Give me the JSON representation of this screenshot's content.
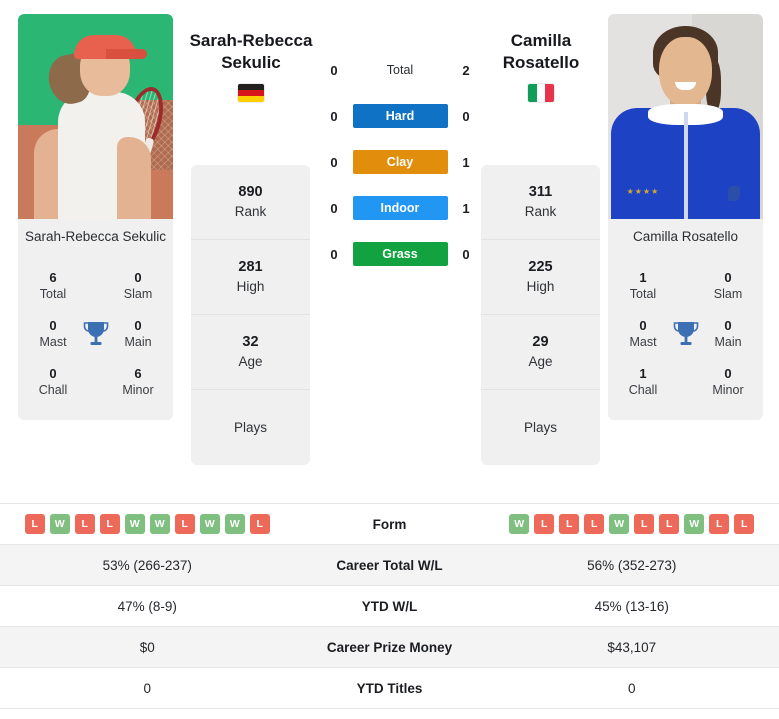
{
  "players": {
    "left": {
      "name": "Sarah-Rebecca Sekulic",
      "name_line1": "Sarah-Rebecca",
      "name_line2": "Sekulic",
      "caption": "Sarah-Rebecca Sekulic",
      "flag": "germany-flag",
      "photo": "player-photo-sekulic",
      "stats": [
        {
          "value": "890",
          "label": "Rank"
        },
        {
          "value": "281",
          "label": "High"
        },
        {
          "value": "32",
          "label": "Age"
        },
        {
          "value": "",
          "label": "Plays"
        }
      ],
      "titles": {
        "total": "6",
        "total_label": "Total",
        "slam": "0",
        "slam_label": "Slam",
        "mast": "0",
        "mast_label": "Mast",
        "main": "0",
        "main_label": "Main",
        "chall": "0",
        "chall_label": "Chall",
        "minor": "6",
        "minor_label": "Minor"
      },
      "form": [
        "L",
        "W",
        "L",
        "L",
        "W",
        "W",
        "L",
        "W",
        "W",
        "L"
      ],
      "career_total_wl": "53% (266-237)",
      "ytd_wl": "47% (8-9)",
      "career_prize_money": "$0",
      "ytd_titles": "0"
    },
    "right": {
      "name": "Camilla Rosatello",
      "name_line1": "Camilla",
      "name_line2": "Rosatello",
      "caption": "Camilla Rosatello",
      "flag": "italy-flag",
      "photo": "player-photo-rosatello",
      "stats": [
        {
          "value": "311",
          "label": "Rank"
        },
        {
          "value": "225",
          "label": "High"
        },
        {
          "value": "29",
          "label": "Age"
        },
        {
          "value": "",
          "label": "Plays"
        }
      ],
      "titles": {
        "total": "1",
        "total_label": "Total",
        "slam": "0",
        "slam_label": "Slam",
        "mast": "0",
        "mast_label": "Mast",
        "main": "0",
        "main_label": "Main",
        "chall": "1",
        "chall_label": "Chall",
        "minor": "0",
        "minor_label": "Minor"
      },
      "form": [
        "W",
        "L",
        "L",
        "L",
        "W",
        "L",
        "L",
        "W",
        "L",
        "L"
      ],
      "career_total_wl": "56% (352-273)",
      "ytd_wl": "45% (13-16)",
      "career_prize_money": "$43,107",
      "ytd_titles": "0"
    }
  },
  "head_to_head": {
    "rows": [
      {
        "label": "Total",
        "left": "0",
        "right": "2",
        "color": ""
      },
      {
        "label": "Hard",
        "left": "0",
        "right": "0",
        "color": "#1072c4"
      },
      {
        "label": "Clay",
        "left": "0",
        "right": "1",
        "color": "#e08e0b"
      },
      {
        "label": "Indoor",
        "left": "0",
        "right": "1",
        "color": "#2196f3"
      },
      {
        "label": "Grass",
        "left": "0",
        "right": "0",
        "color": "#12a23f"
      }
    ]
  },
  "table_labels": {
    "form": "Form",
    "career_total_wl": "Career Total W/L",
    "ytd_wl": "YTD W/L",
    "career_prize_money": "Career Prize Money",
    "ytd_titles": "YTD Titles"
  },
  "colors": {
    "win_badge": "#7fbf7f",
    "loss_badge": "#ed6a5a",
    "trophy": "#3d6fb4",
    "card_bg": "#f0f0f0",
    "row_shade": "#f4f4f4"
  }
}
